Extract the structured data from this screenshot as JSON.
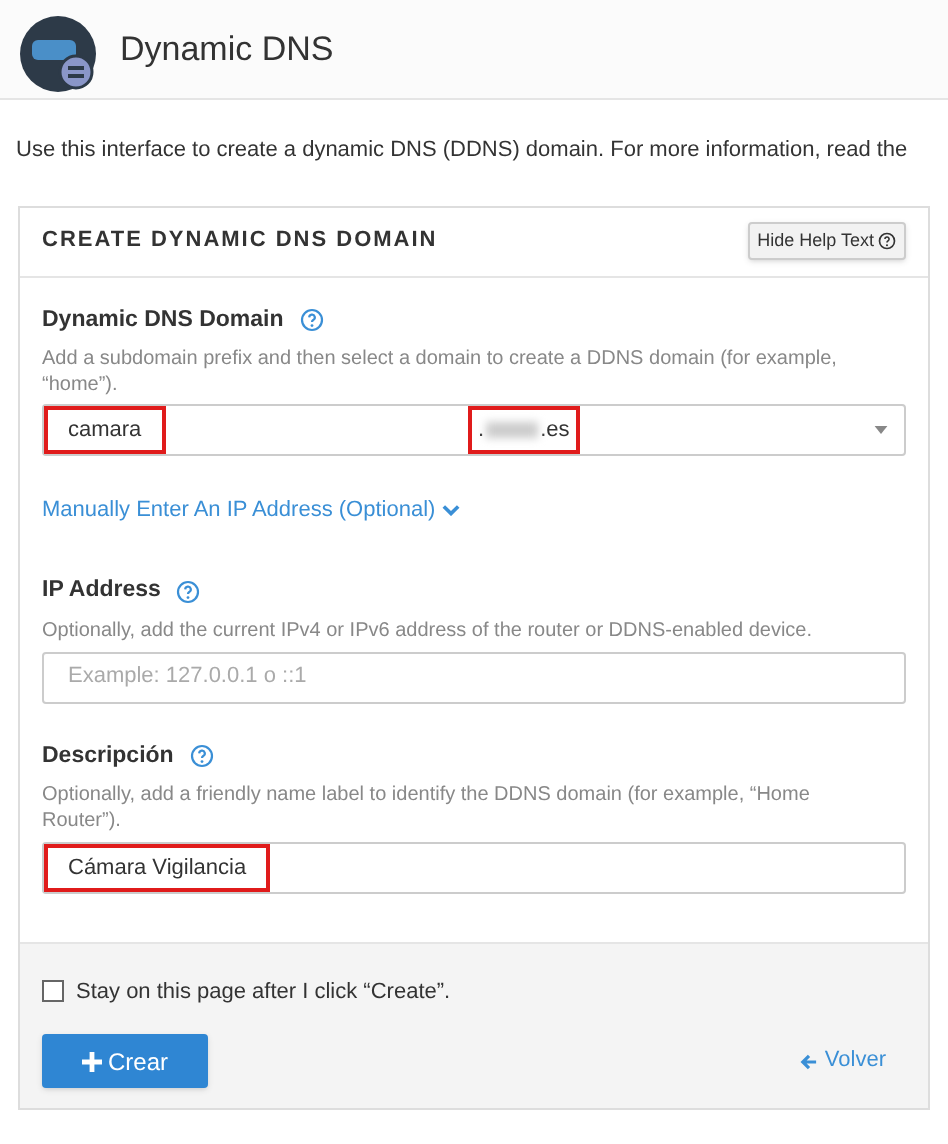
{
  "header": {
    "title": "Dynamic DNS"
  },
  "intro": "Use this interface to create a dynamic DNS (DDNS) domain. For more information, read the",
  "panel": {
    "title": "CREATE DYNAMIC DNS DOMAIN",
    "help_button": "Hide Help Text"
  },
  "domain_field": {
    "label": "Dynamic DNS Domain",
    "help": "Add a subdomain prefix and then select a domain to create a DDNS domain (for example, “home”).",
    "value": "camara",
    "highlighted": true,
    "domain": {
      "start": ".",
      "end": ".es",
      "redacted": true,
      "highlighted": true
    }
  },
  "manual_ip_link": {
    "label": "Manually Enter An IP Address (Optional)",
    "expanded": false
  },
  "ip_field": {
    "label": "IP Address",
    "help": "Optionally, add the current IPv4 or IPv6 address of the router or DDNS-enabled device.",
    "placeholder": "Example: 127.0.0.1 o ::1"
  },
  "description_field": {
    "label": "Descripción",
    "help": "Optionally, add a friendly name label to identify the DDNS domain (for example, “Home Router”).",
    "value": "Cámara Vigilancia",
    "highlighted": true
  },
  "stay_checkbox": {
    "label": "Stay on this page after I click “Create”.",
    "checked": false
  },
  "create_button": {
    "label": "Crear"
  },
  "back_link": {
    "label": "Volver"
  }
}
